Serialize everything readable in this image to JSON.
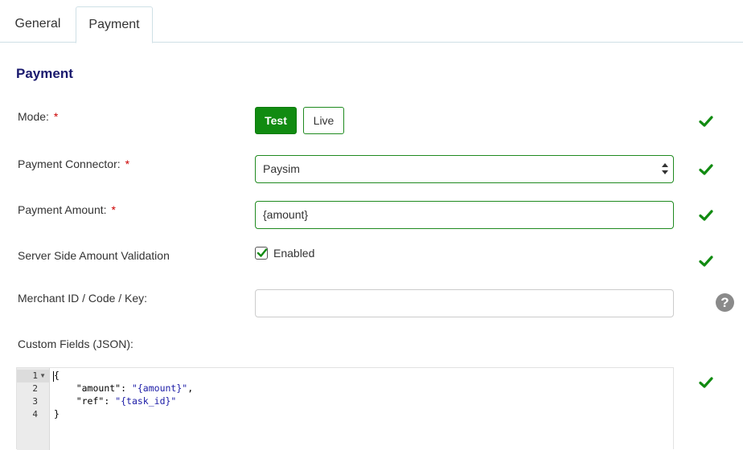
{
  "tabs": [
    {
      "label": "General",
      "active": false
    },
    {
      "label": "Payment",
      "active": true
    }
  ],
  "section": {
    "title": "Payment"
  },
  "fields": {
    "mode": {
      "label": "Mode:",
      "required": "*",
      "options": [
        "Test",
        "Live"
      ],
      "selected": "Test"
    },
    "connector": {
      "label": "Payment Connector:",
      "required": "*",
      "value": "Paysim"
    },
    "amount": {
      "label": "Payment Amount:",
      "required": "*",
      "value": "{amount}"
    },
    "server_validation": {
      "label": "Server Side Amount Validation",
      "checkbox_label": "Enabled",
      "checked": true
    },
    "merchant": {
      "label": "Merchant ID / Code / Key:",
      "value": ""
    },
    "custom": {
      "label": "Custom Fields (JSON):",
      "line_numbers": [
        "1",
        "2",
        "3",
        "4"
      ],
      "lines": [
        {
          "indent": "",
          "key": "{",
          "sep": "",
          "val": "",
          "tail": ""
        },
        {
          "indent": "    ",
          "key": "\"amount\"",
          "sep": ": ",
          "val": "\"{amount}\"",
          "tail": ","
        },
        {
          "indent": "    ",
          "key": "\"ref\"",
          "sep": ": ",
          "val": "\"{task_id}\"",
          "tail": ""
        },
        {
          "indent": "",
          "key": "}",
          "sep": "",
          "val": "",
          "tail": ""
        }
      ]
    }
  },
  "icons": {
    "valid": "check-icon",
    "help": "question-circle-icon",
    "select": "select-arrows-icon",
    "fold": "fold-arrow-icon"
  },
  "colors": {
    "accent_green": "#118b11",
    "title_navy": "#1a1a6e",
    "required_red": "#cc0000",
    "help_gray": "#8a8a8a",
    "json_string": "#1a1aa6"
  }
}
